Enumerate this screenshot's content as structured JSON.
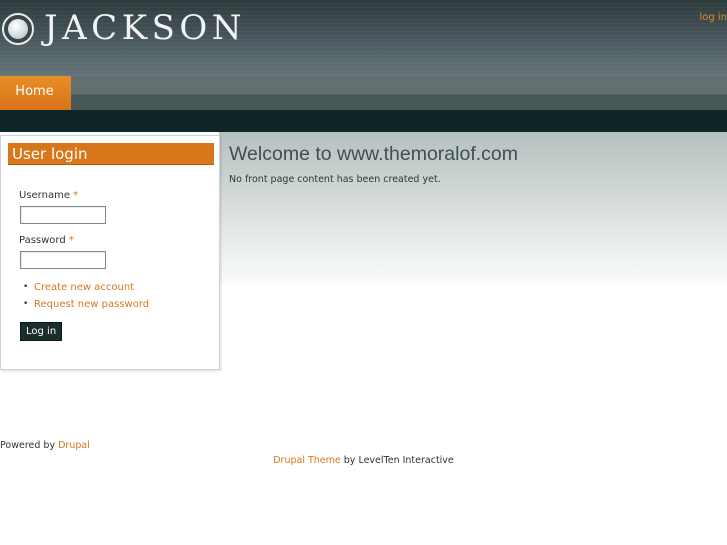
{
  "header": {
    "site_name": "JACKSON",
    "login_link": "log in"
  },
  "nav": {
    "items": [
      {
        "label": "Home"
      }
    ]
  },
  "main": {
    "title": "Welcome to www.themoralof.com",
    "text": "No front page content has been created yet."
  },
  "sidebar": {
    "block_title": "User login",
    "username_label": "Username",
    "password_label": "Password",
    "required_marker": "*",
    "links": [
      {
        "label": "Create new account"
      },
      {
        "label": "Request new password"
      }
    ],
    "submit_label": "Log in"
  },
  "footer": {
    "powered_prefix": "Powered by",
    "powered_link": "Drupal",
    "theme_link": "Drupal Theme",
    "theme_suffix": "by LevelTen Interactive"
  },
  "colors": {
    "accent": "#d8761c",
    "header_dark": "#2e3b3d",
    "band_dark": "#0f2626"
  }
}
